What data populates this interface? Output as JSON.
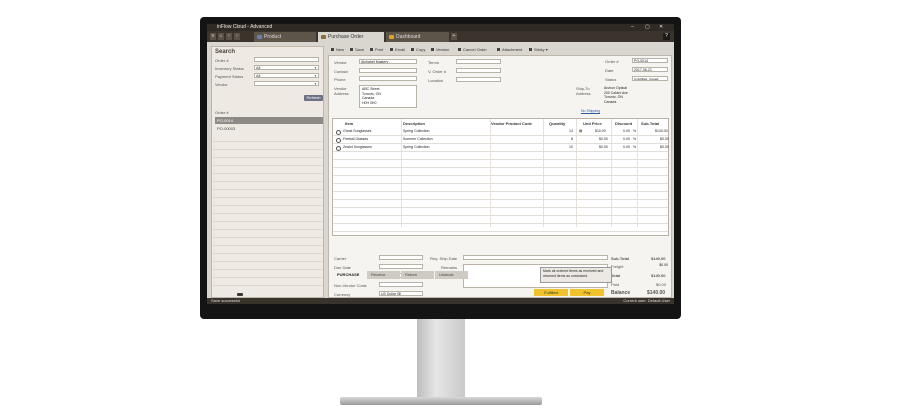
{
  "window": {
    "title": "inFlow Cloud - Advanced",
    "controls": [
      "–",
      "▢",
      "✕"
    ]
  },
  "tabs": [
    {
      "label": "Product",
      "icon": "product-icon",
      "color": "#6c7fb0"
    },
    {
      "label": "Purchase Order",
      "icon": "purchase-order-icon",
      "color": "#8a6d3b"
    },
    {
      "label": "Dashboard",
      "icon": "dashboard-icon",
      "color": "#e0a020"
    }
  ],
  "help_label": "?",
  "search": {
    "title": "Search",
    "fields": [
      {
        "label": "Order #",
        "value": ""
      },
      {
        "label": "Inventory Status",
        "value": "All"
      },
      {
        "label": "Payment Status",
        "value": "All"
      },
      {
        "label": "Vendor",
        "value": ""
      }
    ],
    "refresh_label": "Refresh",
    "list_header": "Order #",
    "orders": [
      "PO-0014",
      "PO-00003"
    ]
  },
  "toolbar": {
    "items": [
      "New",
      "Save",
      "Print",
      "Email",
      "Copy",
      "Version",
      "Cancel Order",
      "Attachment",
      "Sticky"
    ]
  },
  "form": {
    "vendor_label": "Vendor",
    "vendor_value": "Alphabet Mastery",
    "contact_label": "Contact",
    "phone_label": "Phone",
    "vendor_address_label": "Vendor Address",
    "vendor_address": [
      "ABC Street",
      "Toronto, ON",
      "Canada",
      "H0H 0H0"
    ],
    "terms_label": "Terms",
    "vorder_label": "V. Order #",
    "location_label": "Location",
    "order_no_label": "Order #",
    "order_no": "PO-0014",
    "date_label": "Date",
    "date": "2017-06-21",
    "status_label": "Status",
    "status": "Unfulfilled, Unpaid",
    "shipto_label": "Ship-To Address",
    "shipto_address": [
      "Archon Optical",
      "200 Calder Ave",
      "Toronto, ON",
      "Canada"
    ],
    "no_shipping": "No Shipping"
  },
  "grid": {
    "headers": [
      "Item",
      "Description",
      "Vendor Product Code",
      "Quantity",
      "Unit Price",
      "Discount",
      "Sub-Total"
    ],
    "rows": [
      {
        "item": "Ghost Sunglasses",
        "description": "Spring Collection",
        "code": "",
        "qty": "14",
        "price": "$10.00",
        "discount": "0.00",
        "pct": "%",
        "subtotal": "$140.00"
      },
      {
        "item": "Fireball Glasses",
        "description": "Summer Collection",
        "code": "",
        "qty": "8",
        "price": "$0.00",
        "discount": "0.00",
        "pct": "%",
        "subtotal": "$0.00"
      },
      {
        "item": "Zealot Sunglasses",
        "description": "Spring Collection",
        "code": "",
        "qty": "10",
        "price": "$0.00",
        "discount": "0.00",
        "pct": "%",
        "subtotal": "$0.00"
      }
    ]
  },
  "bottom": {
    "carrier_label": "Carrier",
    "duedate_label": "Due Date",
    "taxing_label": "Taxing Scheme",
    "taxing_value": "No Tax",
    "nonvendor_label": "Non-Vendor Costs",
    "currency_label": "Currency",
    "currency_value": "US Dollar ($)",
    "reqship_label": "Req. Ship Date",
    "remarks_label": "Remarks",
    "subtotal_label": "Sub-Total",
    "subtotal_value": "$140.00",
    "freight_label": "Freight",
    "freight_value": "$0.00",
    "total_label": "Total",
    "total_value": "$140.00",
    "paid_label": "Paid",
    "paid_value": "$0.00",
    "balance_label": "Balance",
    "balance_value": "$140.00",
    "fulfilled_label": "Fulfilled",
    "pay_label": "Pay",
    "tooltip": "Mark all ordered items as received and returned items as unstocked."
  },
  "subtabs": [
    "PURCHASE",
    "Receive",
    "Return",
    "Unstock"
  ],
  "status": {
    "left": "Save successful",
    "right": "Current user: Default User"
  }
}
